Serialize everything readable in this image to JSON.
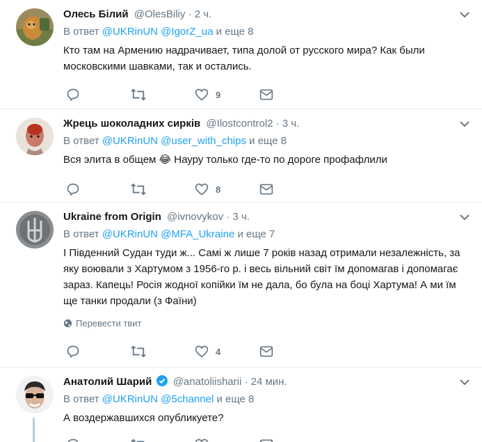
{
  "colors": {
    "link": "#1da1f2",
    "muted": "#657786",
    "divider": "#e6ecf0",
    "thread_line": "#b8ccd9"
  },
  "icons": [
    "reply-icon",
    "retweet-icon",
    "like-icon",
    "direct-message-icon",
    "chevron-down-icon",
    "globe-icon",
    "verified-badge-icon"
  ],
  "tweets": [
    {
      "fullname": "Олесь Білий",
      "username": "@OlesBiliy",
      "dot": "·",
      "time": "2 ч.",
      "reply_prefix": "В ответ",
      "mention1": "@UKRinUN",
      "mention2": "@IgorZ_ua",
      "reply_suffix": "и еще 8",
      "text": "Кто там на Армению надрачивает, типа долой от русского мира? Как были московскими шавками, так и остались.",
      "likes": "9"
    },
    {
      "fullname": "Жрець шоколадних сирків",
      "username": "@Ilostcontrol2",
      "dot": "·",
      "time": "3 ч.",
      "reply_prefix": "В ответ",
      "mention1": "@UKRinUN",
      "mention2": "@user_with_chips",
      "reply_suffix": "и еще 8",
      "text_before": "Вся элита в общем",
      "emoji": "😂",
      "text_after": "Науру только где-то по дороге профафлили",
      "likes": "8"
    },
    {
      "fullname": "Ukraine from Origin",
      "username": "@ivnovykov",
      "dot": "·",
      "time": "3 ч.",
      "reply_prefix": "В ответ",
      "mention1": "@UKRinUN",
      "mention2": "@MFA_Ukraine",
      "reply_suffix": "и еще 7",
      "text": "І Південний Судан туди ж... Самі ж лише 7 років назад отримали незалежність, за яку воювали з Хартумом з 1956-го р. і весь вільний світ їм допомагав і допомагає зараз. Капець! Росія жодної копійки їм не дала, бо була на боці Хартума! А ми їм ще танки продали (з Фаїни)",
      "translate": "Перевести твит",
      "likes": "4"
    },
    {
      "fullname": "Анатолий Шарий",
      "username": "@anatoliisharii",
      "dot": "·",
      "time": "24 мин.",
      "reply_prefix": "В ответ",
      "mention1": "@UKRinUN",
      "mention2": "@5channel",
      "reply_suffix": "и еще 8",
      "text": "А воздержавшихся опубликуете?"
    }
  ]
}
